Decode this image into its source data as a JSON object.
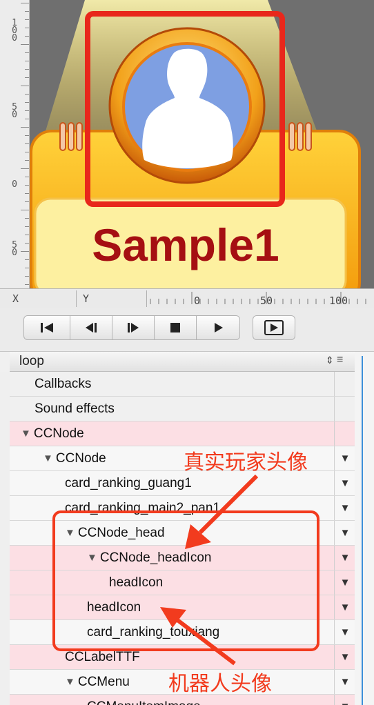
{
  "stage": {
    "card_title": "Sample1",
    "card_color": "#f5b415",
    "title_color": "#a50f12",
    "avatar_bg": "#7e9fe2",
    "highlight_color": "#e8271b"
  },
  "ruler": {
    "vertical_labels": [
      "1\n0\n0",
      "5\n0",
      "0",
      "5\n0"
    ]
  },
  "coord_bar": {
    "x_label": "X",
    "y_label": "Y",
    "ticks": [
      "0",
      "50",
      "100"
    ]
  },
  "transport": {
    "buttons": [
      "jump-to-start",
      "step-back",
      "step-forward",
      "stop",
      "play",
      "play-loop"
    ]
  },
  "timeline": {
    "sequence_name": "loop",
    "rows": [
      {
        "label": "Callbacks",
        "level": 0,
        "kind": "section",
        "has_tri": false,
        "highlight": false,
        "has_dd": false
      },
      {
        "label": "Sound effects",
        "level": 0,
        "kind": "section",
        "has_tri": false,
        "highlight": false,
        "has_dd": false
      },
      {
        "label": "CCNode",
        "level": 0,
        "kind": "node",
        "has_tri": true,
        "highlight": true,
        "has_dd": false
      },
      {
        "label": "CCNode",
        "level": 1,
        "kind": "node",
        "has_tri": true,
        "highlight": false,
        "has_dd": true
      },
      {
        "label": "card_ranking_guang1",
        "level": 2,
        "kind": "node",
        "has_tri": false,
        "highlight": false,
        "has_dd": true
      },
      {
        "label": "card_ranking_main2_pan1",
        "level": 2,
        "kind": "node",
        "has_tri": false,
        "highlight": false,
        "has_dd": true
      },
      {
        "label": "CCNode_head",
        "level": 2,
        "kind": "node",
        "has_tri": true,
        "highlight": false,
        "has_dd": true
      },
      {
        "label": "CCNode_headIcon",
        "level": 3,
        "kind": "node",
        "has_tri": true,
        "highlight": true,
        "has_dd": true
      },
      {
        "label": "headIcon",
        "level": 4,
        "kind": "node",
        "has_tri": false,
        "highlight": true,
        "has_dd": true
      },
      {
        "label": "headIcon",
        "level": 3,
        "kind": "node",
        "has_tri": false,
        "highlight": true,
        "has_dd": true
      },
      {
        "label": "card_ranking_touxiang",
        "level": 3,
        "kind": "node",
        "has_tri": false,
        "highlight": false,
        "has_dd": true
      },
      {
        "label": "CCLabelTTF",
        "level": 2,
        "kind": "node",
        "has_tri": false,
        "highlight": true,
        "has_dd": true
      },
      {
        "label": "CCMenu",
        "level": 2,
        "kind": "node",
        "has_tri": true,
        "highlight": false,
        "has_dd": true
      },
      {
        "label": "CCMenuItemImage",
        "level": 3,
        "kind": "node",
        "has_tri": false,
        "highlight": true,
        "has_dd": true
      }
    ]
  },
  "annotations": {
    "real_player_avatar": "真实玩家头像",
    "robot_avatar": "机器人头像",
    "color": "#f23b1e"
  }
}
